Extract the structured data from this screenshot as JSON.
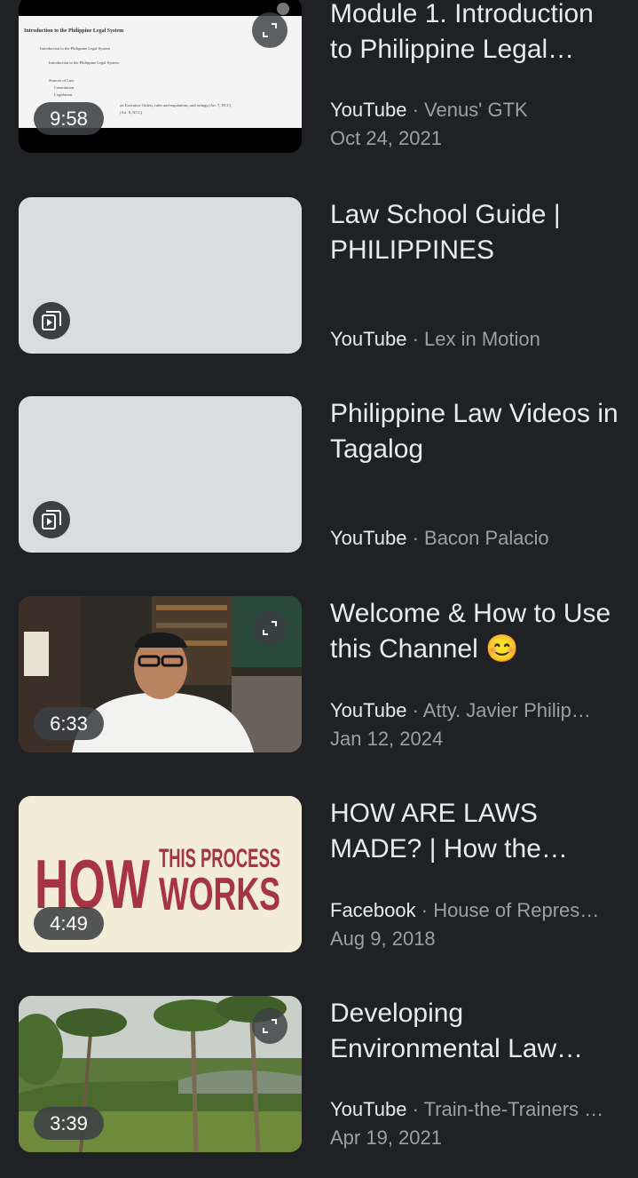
{
  "results": [
    {
      "title": "Module 1. Introduction to Philippine Legal…",
      "source": "YouTube",
      "channel": "Venus' GTK",
      "date": "Oct 24, 2021",
      "duration": "9:58",
      "thumb_text": [
        "Introduction to the Philippine Legal System",
        "Introduction to the Philippine Legal System",
        "Introduction to the Philippine Legal System",
        "Sources of Law",
        "Constitution",
        "Legislation",
        "on Executive Orders, rules and regulations, and rulings (Art. 7, NCC)",
        "(Art. 8, NCC)"
      ]
    },
    {
      "title": "Law School Guide | PHILIPPINES",
      "source": "YouTube",
      "channel": "Lex in Motion"
    },
    {
      "title": "Philippine Law Videos in Tagalog",
      "source": "YouTube",
      "channel": "Bacon Palacio"
    },
    {
      "title": "Welcome & How to Use this Channel 😊",
      "source": "YouTube",
      "channel": "Atty. Javier Philip…",
      "date": "Jan 12, 2024",
      "duration": "6:33"
    },
    {
      "title": "HOW ARE LAWS MADE? | How the…",
      "source": "Facebook",
      "channel": "House of Repres…",
      "date": "Aug 9, 2018",
      "duration": "4:49",
      "thumb_text": {
        "big": "HOW",
        "top": "THIS PROCESS",
        "bottom": "WORKS"
      }
    },
    {
      "title": "Developing Environmental Law…",
      "source": "YouTube",
      "channel": "Train-the-Trainers …",
      "date": "Apr 19, 2021",
      "duration": "3:39"
    }
  ],
  "separator": " · ",
  "colors": {
    "background": "#202124",
    "text": "#e8eaed",
    "muted": "#9aa0a6"
  },
  "icons": {
    "expand": "expand-icon",
    "playlist": "playlist-play-icon"
  }
}
